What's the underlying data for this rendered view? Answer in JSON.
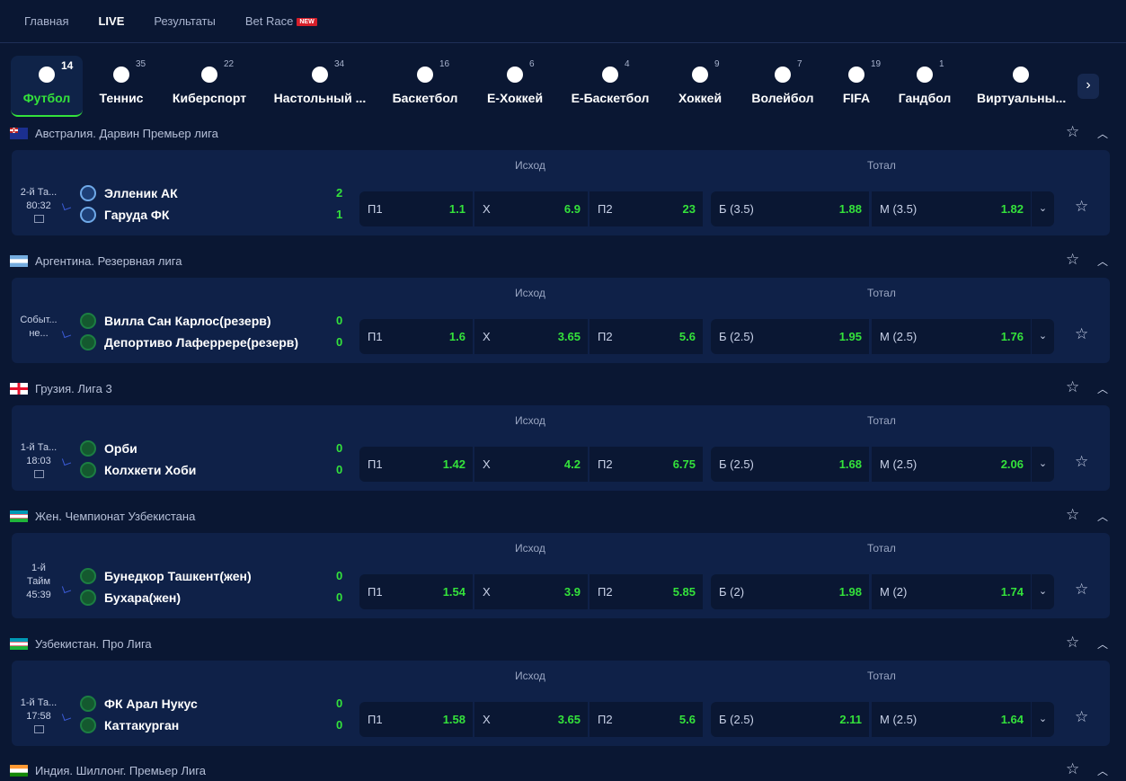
{
  "topnav": [
    {
      "label": "Главная",
      "active": false
    },
    {
      "label": "LIVE",
      "active": true
    },
    {
      "label": "Результаты",
      "active": false
    },
    {
      "label": "Bet Race",
      "active": false,
      "badge": "NEW"
    }
  ],
  "sports": [
    {
      "label": "Футбол",
      "count": "14",
      "icon": "soccer-ball-icon",
      "active": true
    },
    {
      "label": "Теннис",
      "count": "35",
      "icon": "tennis-ball-icon"
    },
    {
      "label": "Киберспорт",
      "count": "22",
      "icon": "gamepad-icon"
    },
    {
      "label": "Настольный ...",
      "count": "34",
      "icon": "table-tennis-icon"
    },
    {
      "label": "Баскетбол",
      "count": "16",
      "icon": "basketball-icon"
    },
    {
      "label": "E-Хоккей",
      "count": "6",
      "icon": "e-hockey-icon"
    },
    {
      "label": "E-Баскетбол",
      "count": "4",
      "icon": "e-basketball-icon"
    },
    {
      "label": "Хоккей",
      "count": "9",
      "icon": "hockey-puck-icon"
    },
    {
      "label": "Волейбол",
      "count": "7",
      "icon": "volleyball-icon"
    },
    {
      "label": "FIFA",
      "count": "19",
      "icon": "fifa-icon"
    },
    {
      "label": "Гандбол",
      "count": "1",
      "icon": "handball-icon"
    },
    {
      "label": "Виртуальны...",
      "count": "",
      "icon": "virtual-sports-icon"
    }
  ],
  "market_headers": {
    "outcome": "Исход",
    "total": "Тотал"
  },
  "leagues": [
    {
      "name": "Австралия. Дарвин Премьер лига",
      "flag": "australia",
      "match": {
        "time_lines": [
          "2-й Та...",
          "80:32"
        ],
        "teams": [
          {
            "name": "Элленик АК",
            "score": "2",
            "logo": "blue"
          },
          {
            "name": "Гаруда ФК",
            "score": "1",
            "logo": "blue"
          }
        ],
        "odds": [
          {
            "label": "П1",
            "value": "1.1"
          },
          {
            "label": "X",
            "value": "6.9"
          },
          {
            "label": "П2",
            "value": "23"
          },
          {
            "label": "Б (3.5)",
            "value": "1.88"
          },
          {
            "label": "М (3.5)",
            "value": "1.82"
          }
        ]
      }
    },
    {
      "name": "Аргентина. Резервная лига",
      "flag": "argentina",
      "match": {
        "time_lines": [
          "Событ...",
          "не..."
        ],
        "teams": [
          {
            "name": "Вилла Сан Карлос(резерв)",
            "score": "0",
            "logo": "green"
          },
          {
            "name": "Депортиво Лаферрере(резерв)",
            "score": "0",
            "logo": "green"
          }
        ],
        "odds": [
          {
            "label": "П1",
            "value": "1.6"
          },
          {
            "label": "X",
            "value": "3.65"
          },
          {
            "label": "П2",
            "value": "5.6"
          },
          {
            "label": "Б (2.5)",
            "value": "1.95"
          },
          {
            "label": "М (2.5)",
            "value": "1.76"
          }
        ]
      }
    },
    {
      "name": "Грузия. Лига 3",
      "flag": "georgia",
      "match": {
        "time_lines": [
          "1-й Та...",
          "18:03"
        ],
        "teams": [
          {
            "name": "Орби",
            "score": "0",
            "logo": "green"
          },
          {
            "name": "Колхкети Хоби",
            "score": "0",
            "logo": "green"
          }
        ],
        "odds": [
          {
            "label": "П1",
            "value": "1.42"
          },
          {
            "label": "X",
            "value": "4.2"
          },
          {
            "label": "П2",
            "value": "6.75"
          },
          {
            "label": "Б (2.5)",
            "value": "1.68"
          },
          {
            "label": "М (2.5)",
            "value": "2.06"
          }
        ]
      }
    },
    {
      "name": "Жен. Чемпионат Узбекистана",
      "flag": "uzbekistan",
      "match": {
        "time_lines": [
          "1-й",
          "Тайм",
          "45:39"
        ],
        "teams": [
          {
            "name": "Бунедкор Ташкент(жен)",
            "score": "0",
            "logo": "green"
          },
          {
            "name": "Бухара(жен)",
            "score": "0",
            "logo": "green"
          }
        ],
        "odds": [
          {
            "label": "П1",
            "value": "1.54"
          },
          {
            "label": "X",
            "value": "3.9"
          },
          {
            "label": "П2",
            "value": "5.85"
          },
          {
            "label": "Б (2)",
            "value": "1.98"
          },
          {
            "label": "М (2)",
            "value": "1.74"
          }
        ]
      }
    },
    {
      "name": "Узбекистан. Про Лига",
      "flag": "uzbekistan",
      "match": {
        "time_lines": [
          "1-й Та...",
          "17:58"
        ],
        "teams": [
          {
            "name": "ФК Арал Нукус",
            "score": "0",
            "logo": "green"
          },
          {
            "name": "Каттакурган",
            "score": "0",
            "logo": "green"
          }
        ],
        "odds": [
          {
            "label": "П1",
            "value": "1.58"
          },
          {
            "label": "X",
            "value": "3.65"
          },
          {
            "label": "П2",
            "value": "5.6"
          },
          {
            "label": "Б (2.5)",
            "value": "2.11"
          },
          {
            "label": "М (2.5)",
            "value": "1.64"
          }
        ]
      }
    },
    {
      "name": "Индия. Шиллонг. Премьер Лига",
      "flag": "india"
    }
  ]
}
